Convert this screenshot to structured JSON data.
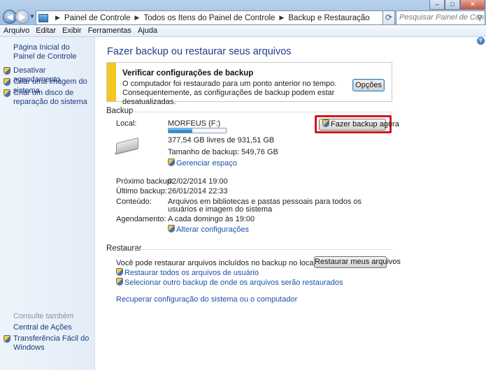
{
  "window": {
    "search_placeholder": "Pesquisar Painel de Controle"
  },
  "address": {
    "crumbs": [
      "Painel de Controle",
      "Todos os Itens do Painel de Controle",
      "Backup e Restauração"
    ]
  },
  "menu": [
    "Arquivo",
    "Editar",
    "Exibir",
    "Ferramentas",
    "Ajuda"
  ],
  "sidebar": {
    "home": "Página Inicial do Painel de Controle",
    "items": [
      {
        "label": "Desativar agendamento",
        "icon": "shield-icon"
      },
      {
        "label": "Criar uma imagem do sistema",
        "icon": "shield-icon"
      },
      {
        "label": "Criar um disco de reparação do sistema",
        "icon": "shield-icon"
      }
    ],
    "see_also_title": "Consulte também",
    "see_also": [
      {
        "label": "Central de Ações"
      },
      {
        "label": "Transferência Fácil do Windows",
        "icon": "shield-icon"
      }
    ]
  },
  "main": {
    "title": "Fazer backup ou restaurar seus arquivos",
    "warning": {
      "title": "Verificar configurações de backup",
      "text": "O computador foi restaurado para um ponto anterior no tempo. Consequentemente, as configurações de backup podem estar desatualizadas.",
      "button": "Opções"
    },
    "backup": {
      "section": "Backup",
      "local_label": "Local:",
      "drive_name": "MORFEUS (F:)",
      "usage_fraction": 0.41,
      "free_space": "377,54 GB livres de 931,51 GB",
      "backup_size": "Tamanho de backup: 549,76 GB",
      "manage_space": "Gerenciar espaço",
      "backup_now_button": "Fazer backup agora",
      "next_label": "Próximo backup:",
      "next_value": "02/02/2014 19:00",
      "last_label": "Último backup:",
      "last_value": "26/01/2014 22:33",
      "content_label": "Conteúdo:",
      "content_value_line1": "Arquivos em bibliotecas e pastas pessoais para todos os",
      "content_value_line2": "usuários e imagem do sistema",
      "schedule_label": "Agendamento:",
      "schedule_value": "A cada domingo às 19:00",
      "change_settings": "Alterar configurações"
    },
    "restore": {
      "section": "Restaurar",
      "text": "Você pode restaurar arquivos incluídos no backup no local atual.",
      "button": "Restaurar meus arquivos",
      "restore_all_users": "Restaurar todos os arquivos de usuário",
      "select_other": "Selecionar outro backup de onde os arquivos serão restaurados",
      "recover_system": "Recuperar configuração do sistema ou o computador"
    }
  },
  "colors": {
    "warning_bar": "#f4c623",
    "highlight_border": "#d3161c",
    "link": "#1c50a8",
    "heading": "#1e3f87"
  }
}
